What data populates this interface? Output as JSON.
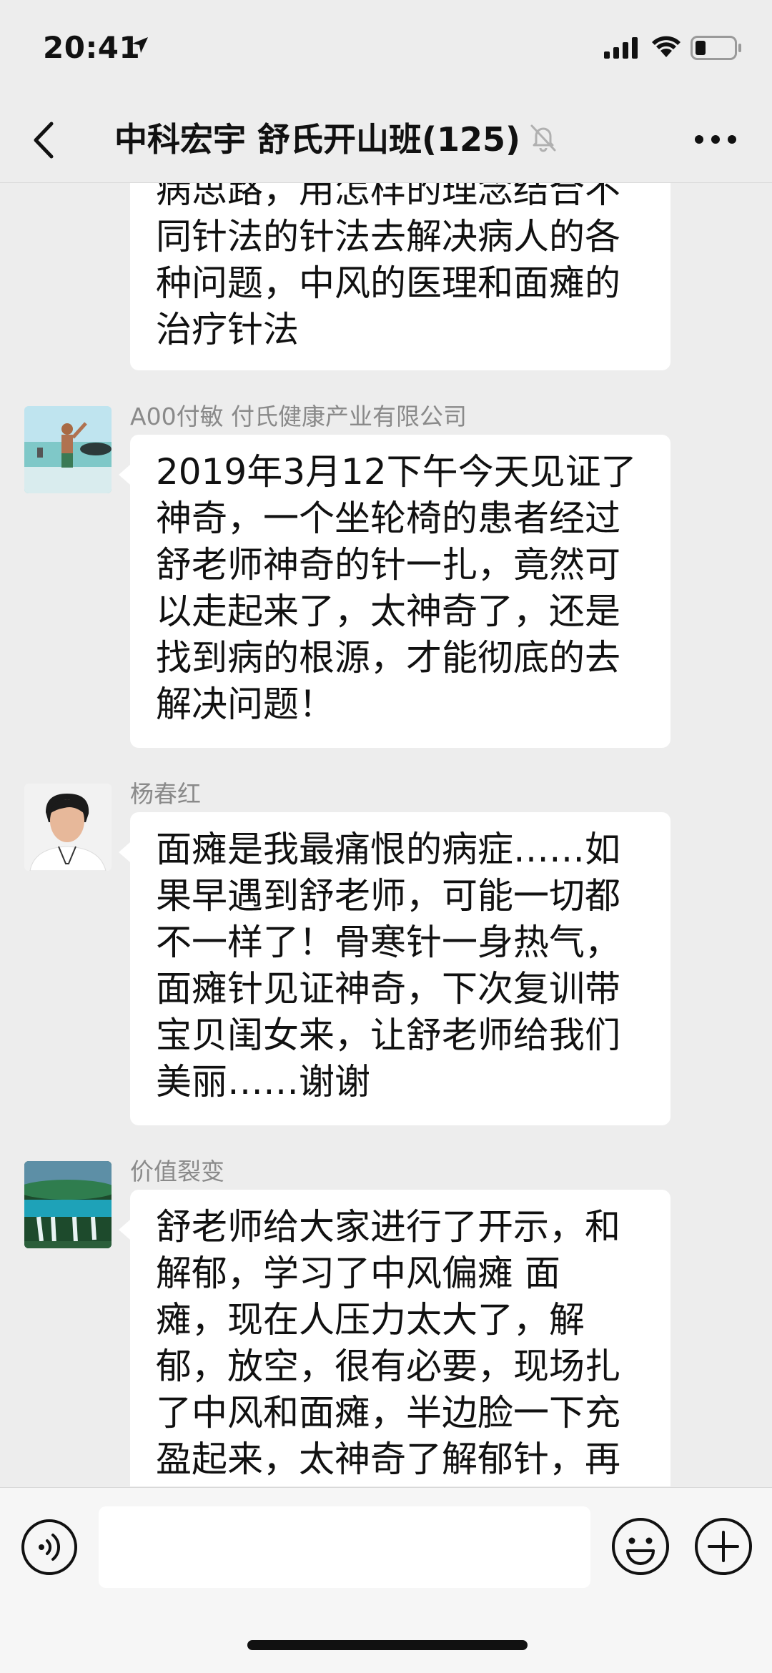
{
  "status_bar": {
    "time": "20:41",
    "icons": [
      "location-arrow-icon",
      "cellular-signal-icon",
      "wifi-icon",
      "battery-icon"
    ]
  },
  "nav": {
    "back_icon": "chevron-left-icon",
    "title": "中科宏宇 舒氏开山班(125)",
    "mute_icon": "muted-bell-icon",
    "more_icon": "more-dots-icon"
  },
  "messages": [
    {
      "sender": "",
      "lines": [
        "病思路，用怎样的理念结合不",
        "同针法的针法去解决病人的各",
        "种问题，中风的医理和面瘫的",
        "治疗针法"
      ]
    },
    {
      "sender": "A00付敏 付氏健康产业有限公司",
      "lines": [
        "2019年3月12下午今天见证了",
        "神奇，一个坐轮椅的患者经过",
        "舒老师神奇的针一扎，竟然可",
        "以走起来了，太神奇了，还是",
        "找到病的根源，才能彻底的去",
        "解决问题！"
      ]
    },
    {
      "sender": "杨春红",
      "lines": [
        "面瘫是我最痛恨的病症……如",
        "果早遇到舒老师，可能一切都",
        "不一样了！骨寒针一身热气，",
        "面瘫针见证神奇，下次复训带",
        "宝贝闺女来，让舒老师给我们",
        "美丽……谢谢"
      ]
    },
    {
      "sender": "价值裂变",
      "lines": [
        "舒老师给大家进行了开示，和",
        "解郁，学习了中风偏瘫 面",
        "瘫，现在人压力太大了，解",
        "郁，放空，很有必要，现场扎",
        "了中风和面瘫，半边脸一下充",
        "盈起来，太神奇了解郁针，再"
      ]
    }
  ],
  "input_bar": {
    "voice_icon": "voice-input-icon",
    "text_value": "",
    "emoji_icon": "emoji-icon",
    "plus_icon": "plus-icon"
  },
  "colors": {
    "background": "#ededed",
    "bubble": "#ffffff",
    "sender_text": "#8a8a8a"
  }
}
